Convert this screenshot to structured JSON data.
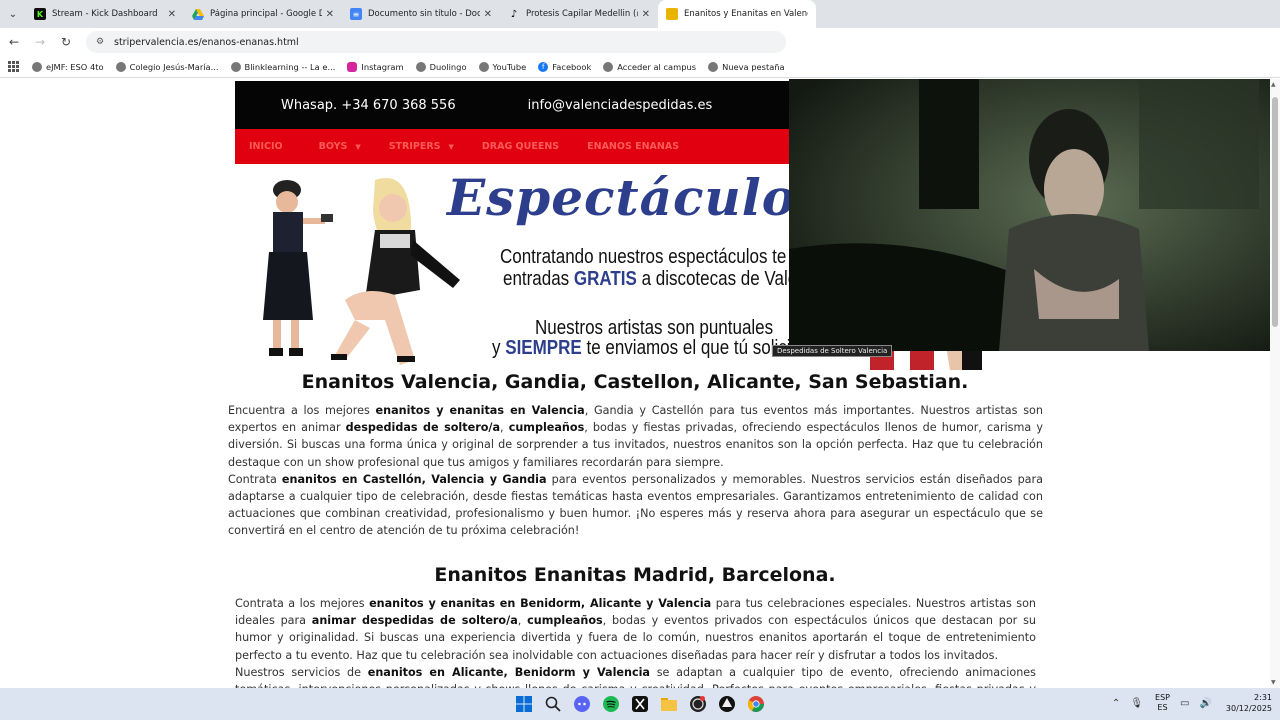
{
  "tabs": [
    {
      "title": "Stream - Kick Dashboard",
      "color": "#53fc18",
      "icon": "kick-icon"
    },
    {
      "title": "Página principal - Google Drive",
      "color": "#1fa463",
      "icon": "drive-icon"
    },
    {
      "title": "Documento sin título - Docum",
      "color": "#4285f4",
      "icon": "docs-icon"
    },
    {
      "title": "Protesis Capilar Medellin (@pro",
      "color": "#000000",
      "icon": "tiktok-icon"
    },
    {
      "title": "Enanitos y Enanitas en Valencia",
      "color": "#e8b400",
      "icon": "site-icon"
    }
  ],
  "address": {
    "url": "stripervalencia.es/enanos-enanas.html"
  },
  "bookmarks": [
    {
      "label": "eJMF: ESO 4to",
      "icon": "globe-icon"
    },
    {
      "label": "Colegio Jesús-María...",
      "icon": "globe-icon"
    },
    {
      "label": "Blinklearning -- La e...",
      "icon": "globe-icon"
    },
    {
      "label": "Instagram",
      "icon": "instagram-icon"
    },
    {
      "label": "Duolingo",
      "icon": "globe-icon"
    },
    {
      "label": "YouTube",
      "icon": "globe-icon"
    },
    {
      "label": "Facebook",
      "icon": "facebook-icon"
    },
    {
      "label": "Acceder al campus",
      "icon": "globe-icon"
    },
    {
      "label": "Nueva pestaña",
      "icon": "globe-icon"
    }
  ],
  "site": {
    "whatsapp": "Whasap. +34 670 368 556",
    "email": "info@valenciadespedidas.es",
    "menu": [
      "INICIO",
      "BOYS",
      "STRIPERS",
      "DRAG QUEENS",
      "ENANOS ENANAS"
    ],
    "banner": {
      "script_title": "Espectáculos Vale",
      "line1": "Contratando nuestros espectáculos te",
      "line2_pre": "entradas ",
      "line2_bold": "GRATIS",
      "line2_post": " a discotecas de Valencia",
      "line3": "Nuestros artistas son puntuales",
      "line4_pre": "y ",
      "line4_bold": "SIEMPRE",
      "line4_post": " te enviamos el que tú solicites"
    },
    "tooltip": "Despedidas de Soltero Valencia",
    "heading1": "Enanitos Valencia, Gandia, Castellon, Alicante, San Sebastian.",
    "heading2": "Enanitos Enanitas Madrid, Barcelona."
  },
  "taskbar": {
    "lang1": "ESP",
    "lang2": "ES",
    "time": "2:31",
    "date": "30/12/2025"
  }
}
